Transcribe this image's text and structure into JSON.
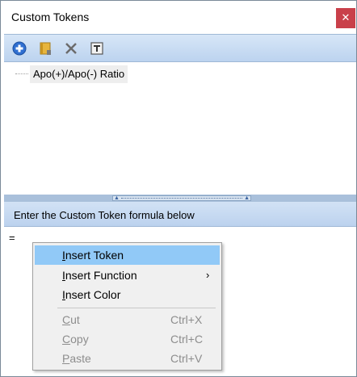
{
  "window": {
    "title": "Custom Tokens",
    "close_glyph": "✕"
  },
  "toolbar": {
    "buttons": [
      {
        "name": "add-token",
        "icon": "plus-circle-icon"
      },
      {
        "name": "token-folder",
        "icon": "notebook-icon"
      },
      {
        "name": "delete-token",
        "icon": "x-delete-icon"
      },
      {
        "name": "text-format",
        "icon": "text-tool-icon"
      }
    ]
  },
  "tree": {
    "items": [
      {
        "label": "Apo(+)/Apo(-) Ratio"
      }
    ]
  },
  "formula": {
    "header": "Enter the Custom Token formula below",
    "value": "="
  },
  "context_menu": {
    "items": [
      {
        "label": "Insert Token",
        "mnemonic": "I",
        "rest": "nsert Token",
        "shortcut": "",
        "highlighted": true,
        "enabled": true
      },
      {
        "label": "Insert Function",
        "mnemonic": "I",
        "rest": "nsert Function",
        "shortcut": "",
        "submenu": "›",
        "enabled": true
      },
      {
        "label": "Insert Color",
        "mnemonic": "I",
        "rest": "nsert Color",
        "shortcut": "",
        "enabled": true
      },
      {
        "label": "Cut",
        "mnemonic": "C",
        "rest": "ut",
        "shortcut": "Ctrl+X",
        "enabled": false
      },
      {
        "label": "Copy",
        "mnemonic": "C",
        "rest": "opy",
        "shortcut": "Ctrl+C",
        "enabled": false
      },
      {
        "label": "Paste",
        "mnemonic": "P",
        "rest": "aste",
        "shortcut": "Ctrl+V",
        "enabled": false
      }
    ]
  },
  "colors": {
    "accent": "#91c9f7",
    "toolbar": "#bcd3ef",
    "close": "#c9404a"
  }
}
